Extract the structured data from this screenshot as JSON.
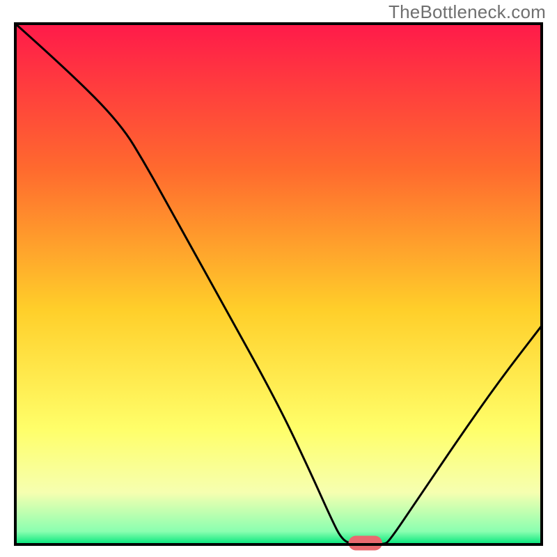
{
  "attribution": "TheBottleneck.com",
  "colors": {
    "gradient_top": "#ff1a4a",
    "gradient_mid1": "#ff6a2e",
    "gradient_mid2": "#ffcf2a",
    "gradient_mid3": "#ffff6a",
    "gradient_mid4": "#f6ffb0",
    "gradient_bottom": "#00e57a",
    "border": "#000000",
    "curve": "#000000",
    "marker": "#e96a6f"
  },
  "chart_data": {
    "type": "line",
    "title": "",
    "xlabel": "",
    "ylabel": "",
    "xlim": [
      0,
      100
    ],
    "ylim": [
      0,
      100
    ],
    "gradient_stops": [
      {
        "offset": 0.0,
        "color": "#ff1a4a"
      },
      {
        "offset": 0.28,
        "color": "#ff6a2e"
      },
      {
        "offset": 0.55,
        "color": "#ffcf2a"
      },
      {
        "offset": 0.78,
        "color": "#ffff6a"
      },
      {
        "offset": 0.9,
        "color": "#f6ffb0"
      },
      {
        "offset": 0.975,
        "color": "#8affb0"
      },
      {
        "offset": 1.0,
        "color": "#00e57a"
      }
    ],
    "curve": [
      {
        "x": 0.0,
        "y": 100.0
      },
      {
        "x": 10.0,
        "y": 91.0
      },
      {
        "x": 20.0,
        "y": 80.8
      },
      {
        "x": 25.0,
        "y": 72.5
      },
      {
        "x": 30.0,
        "y": 63.3
      },
      {
        "x": 40.0,
        "y": 45.2
      },
      {
        "x": 50.0,
        "y": 26.8
      },
      {
        "x": 56.0,
        "y": 14.0
      },
      {
        "x": 60.0,
        "y": 5.0
      },
      {
        "x": 62.0,
        "y": 1.0
      },
      {
        "x": 64.0,
        "y": 0.0
      },
      {
        "x": 70.0,
        "y": 0.0
      },
      {
        "x": 71.0,
        "y": 0.6
      },
      {
        "x": 76.0,
        "y": 8.0
      },
      {
        "x": 84.0,
        "y": 20.0
      },
      {
        "x": 92.0,
        "y": 31.5
      },
      {
        "x": 100.0,
        "y": 42.0
      }
    ],
    "marker": {
      "x": 66.5,
      "y": 0.0,
      "rx": 3.2,
      "ry": 1.4
    }
  }
}
